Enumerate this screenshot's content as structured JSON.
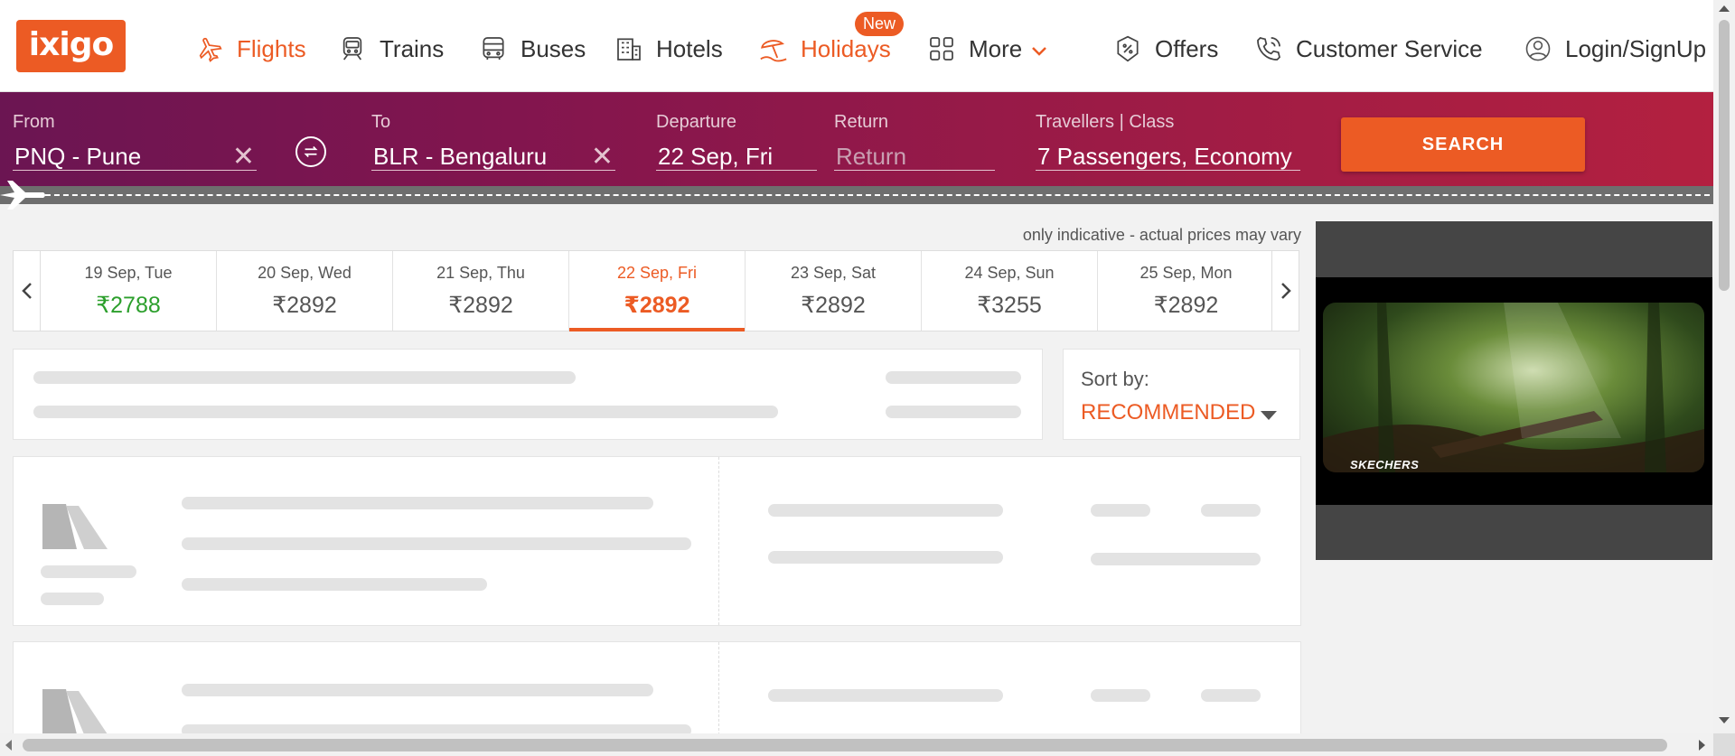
{
  "brand": {
    "logo_text": "ixigo",
    "accent": "#ec5b24"
  },
  "nav": {
    "flights": "Flights",
    "trains": "Trains",
    "buses": "Buses",
    "hotels": "Hotels",
    "holidays": "Holidays",
    "holidays_badge": "New",
    "more": "More",
    "offers": "Offers",
    "customer_service": "Customer Service",
    "login": "Login/SignUp"
  },
  "search": {
    "from_label": "From",
    "from_value": "PNQ - Pune",
    "to_label": "To",
    "to_value": "BLR - Bengaluru",
    "departure_label": "Departure",
    "departure_value": "22 Sep, Fri",
    "return_label": "Return",
    "return_placeholder": "Return",
    "travellers_label": "Travellers | Class",
    "travellers_value": "7 Passengers, Economy",
    "search_button": "SEARCH"
  },
  "fare_calendar": {
    "note": "only indicative - actual prices may vary",
    "currency": "₹",
    "dates": [
      {
        "date": "19 Sep, Tue",
        "price": "₹2788",
        "cheapest": true
      },
      {
        "date": "20 Sep, Wed",
        "price": "₹2892"
      },
      {
        "date": "21 Sep, Thu",
        "price": "₹2892"
      },
      {
        "date": "22 Sep, Fri",
        "price": "₹2892",
        "selected": true
      },
      {
        "date": "23 Sep, Sat",
        "price": "₹2892"
      },
      {
        "date": "24 Sep, Sun",
        "price": "₹3255"
      },
      {
        "date": "25 Sep, Mon",
        "price": "₹2892"
      }
    ]
  },
  "sort": {
    "label": "Sort by:",
    "value": "RECOMMENDED"
  },
  "ad": {
    "brand_text": "SKECHERS"
  }
}
